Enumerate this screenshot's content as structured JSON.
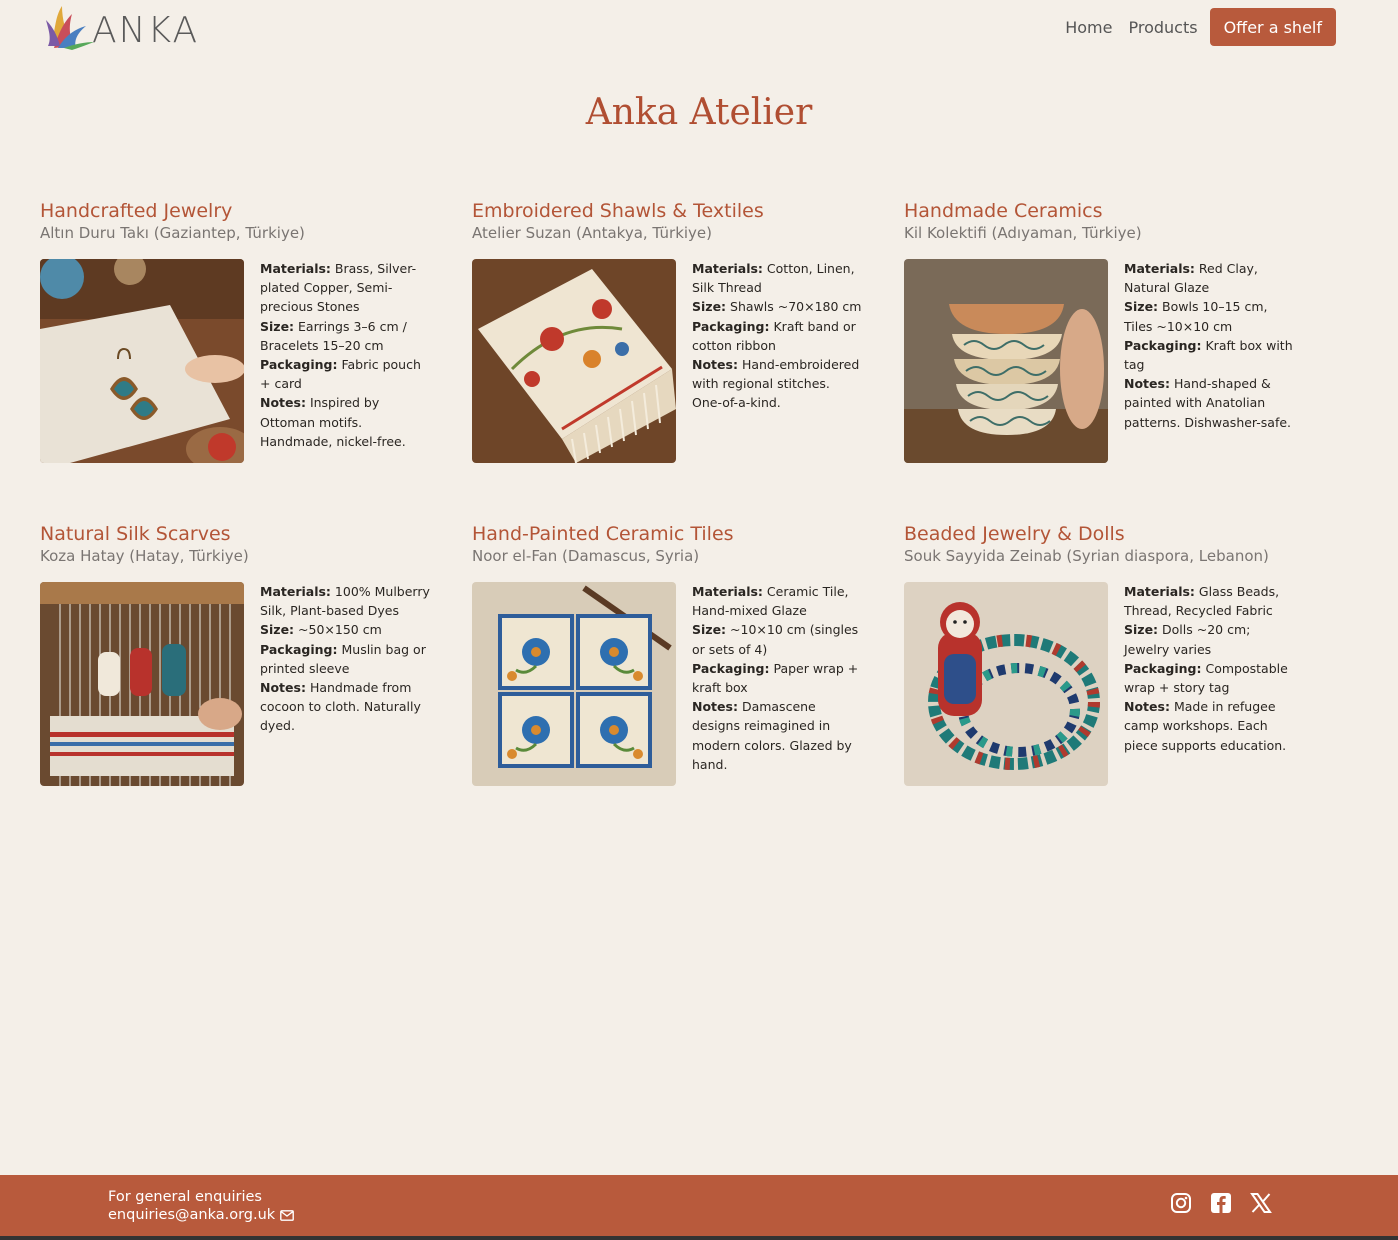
{
  "brand": {
    "name": "ANKA"
  },
  "nav": {
    "home": "Home",
    "products": "Products",
    "cta": "Offer a shelf"
  },
  "page_title": "Anka Atelier",
  "spec_labels": {
    "materials": "Materials:",
    "size": "Size:",
    "packaging": "Packaging:",
    "notes": "Notes:"
  },
  "products": [
    {
      "title": "Handcrafted Jewelry",
      "maker": "Altın Duru Takı (Gaziantep, Türkiye)",
      "image_icon": "jewelry-photo",
      "materials": "Brass, Silver-plated Copper, Semi-precious Stones",
      "size": "Earrings 3–6 cm / Bracelets 15–20 cm",
      "packaging": "Fabric pouch + card",
      "notes": "Inspired by Ottoman motifs. Handmade, nickel-free."
    },
    {
      "title": "Embroidered Shawls & Textiles",
      "maker": "Atelier Suzan (Antakya, Türkiye)",
      "image_icon": "shawl-photo",
      "materials": "Cotton, Linen, Silk Thread",
      "size": "Shawls ~70×180 cm",
      "packaging": "Kraft band or cotton ribbon",
      "notes": "Hand-embroidered with regional stitches. One-of-a-kind."
    },
    {
      "title": "Handmade Ceramics",
      "maker": "Kil Kolektifi (Adıyaman, Türkiye)",
      "image_icon": "ceramics-photo",
      "materials": "Red Clay, Natural Glaze",
      "size": "Bowls 10–15 cm, Tiles ~10×10 cm",
      "packaging": "Kraft box with tag",
      "notes": "Hand-shaped & painted with Anatolian patterns. Dishwasher-safe."
    },
    {
      "title": "Natural Silk Scarves",
      "maker": "Koza Hatay (Hatay, Türkiye)",
      "image_icon": "loom-photo",
      "materials": "100% Mulberry Silk, Plant-based Dyes",
      "size": "~50×150 cm",
      "packaging": "Muslin bag or printed sleeve",
      "notes": "Handmade from cocoon to cloth. Naturally dyed."
    },
    {
      "title": "Hand-Painted Ceramic Tiles",
      "maker": "Noor el-Fan (Damascus, Syria)",
      "image_icon": "tiles-photo",
      "materials": "Ceramic Tile, Hand-mixed Glaze",
      "size": "~10×10 cm (singles or sets of 4)",
      "packaging": "Paper wrap + kraft box",
      "notes": "Damascene designs reimagined in modern colors. Glazed by hand."
    },
    {
      "title": "Beaded Jewelry & Dolls",
      "maker": "Souk Sayyida Zeinab (Syrian diaspora, Lebanon)",
      "image_icon": "beads-doll-photo",
      "materials": "Glass Beads, Thread, Recycled Fabric",
      "size": "Dolls ~20 cm; Jewelry varies",
      "packaging": "Compostable wrap + story tag",
      "notes": "Made in refugee camp workshops. Each piece supports education."
    }
  ],
  "footer": {
    "enquiries_label": "For general enquiries",
    "email": "enquiries@anka.org.uk",
    "socials": [
      "instagram-icon",
      "facebook-icon",
      "x-icon"
    ]
  },
  "colors": {
    "accent": "#b85a3c",
    "title": "#b04e32",
    "background": "#f4efe8"
  }
}
